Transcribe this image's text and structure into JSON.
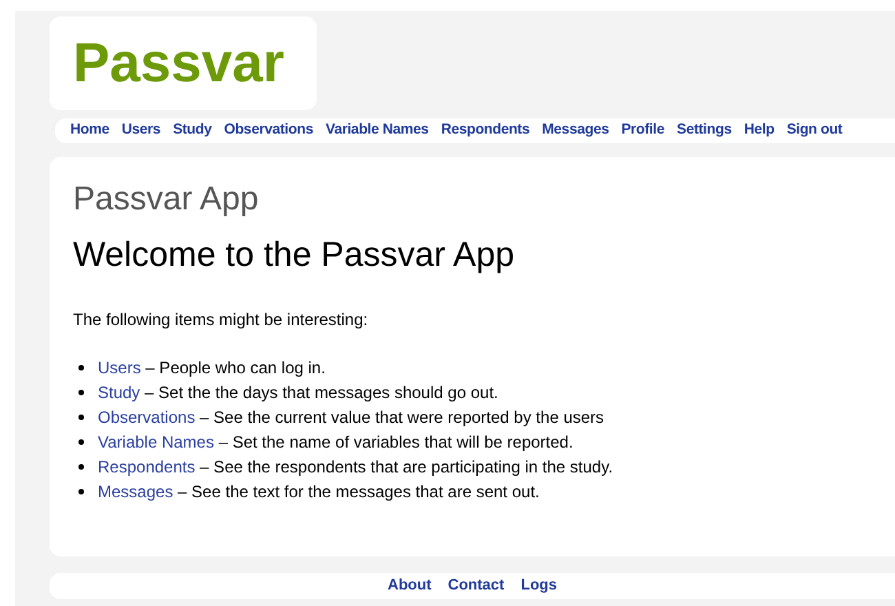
{
  "logo": "Passvar",
  "nav": [
    "Home",
    "Users",
    "Study",
    "Observations",
    "Variable Names",
    "Respondents",
    "Messages",
    "Profile",
    "Settings",
    "Help",
    "Sign out"
  ],
  "content": {
    "app_title": "Passvar App",
    "heading": "Welcome to the Passvar App",
    "intro": "The following items might be interesting:",
    "items": [
      {
        "link": "Users",
        "description": " – People who can log in."
      },
      {
        "link": "Study",
        "description": " – Set the the days that messages should go out."
      },
      {
        "link": "Observations",
        "description": " – See the current value that were reported by the users"
      },
      {
        "link": "Variable Names",
        "description": " – Set the name of variables that will be reported."
      },
      {
        "link": "Respondents",
        "description": " – See the respondents that are participating in the study."
      },
      {
        "link": "Messages",
        "description": " – See the text for the messages that are sent out."
      }
    ]
  },
  "footer": [
    "About",
    "Contact",
    "Logs"
  ]
}
